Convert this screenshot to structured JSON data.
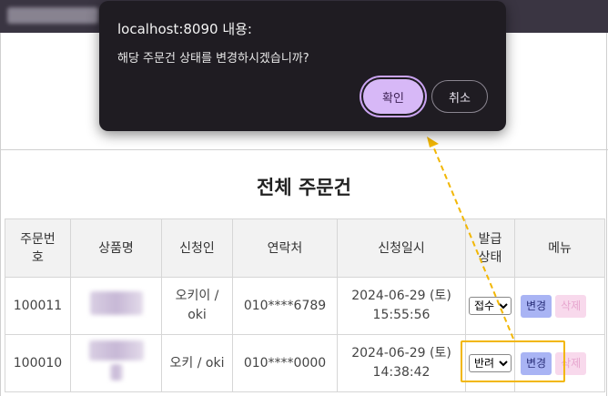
{
  "dialog": {
    "title": "localhost:8090 내용:",
    "message": "해당 주문건 상태를 변경하시겠습니까?",
    "ok_label": "확인",
    "cancel_label": "취소"
  },
  "page": {
    "title": "전체 주문건"
  },
  "table": {
    "headers": [
      "주문번호",
      "상품명",
      "신청인",
      "연락처",
      "신청일시",
      "발급\n상태",
      "메뉴"
    ],
    "rows": [
      {
        "order_no": "100011",
        "applicant": "오키이 / oki",
        "phone": "010****6789",
        "date": "2024-06-29 (토)",
        "time": "15:55:56",
        "status": "접수",
        "change_label": "변경",
        "delete_label": "삭제"
      },
      {
        "order_no": "100010",
        "applicant": "오키 / oki",
        "phone": "010****0000",
        "date": "2024-06-29 (토)",
        "time": "14:38:42",
        "status": "반려",
        "change_label": "변경",
        "delete_label": "삭제"
      }
    ]
  },
  "colors": {
    "highlight": "#f2b705",
    "dialog_bg": "#1f1c22",
    "ok_button": "#d7b8f7",
    "change_button": "#a9b4f4",
    "delete_button": "#f8d9ec"
  }
}
